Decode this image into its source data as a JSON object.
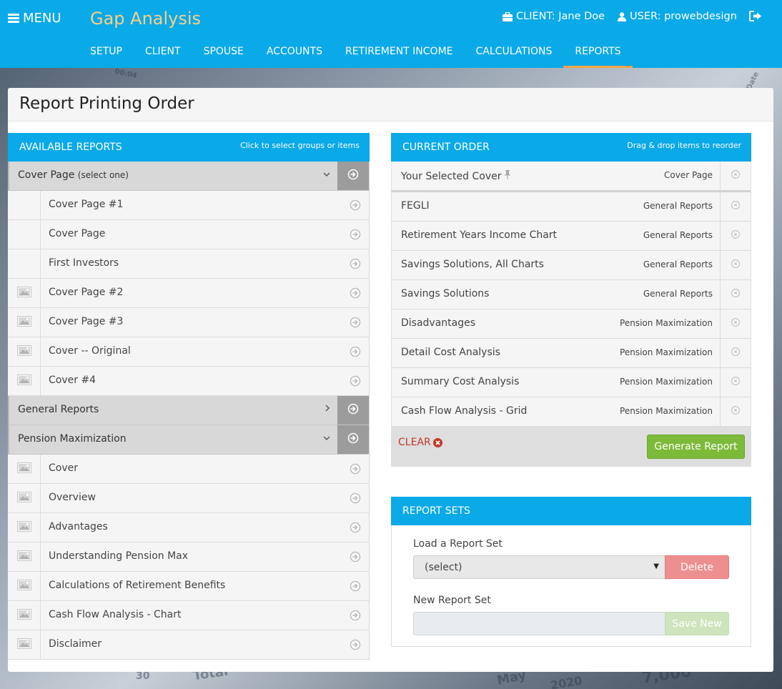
{
  "header": {
    "menu_label": "MENU",
    "app_title": "Gap Analysis",
    "client_label": "CLIENT: Jane Doe",
    "user_label": "USER: prowebdesign"
  },
  "nav": [
    "SETUP",
    "CLIENT",
    "SPOUSE",
    "ACCOUNTS",
    "RETIREMENT INCOME",
    "CALCULATIONS",
    "REPORTS"
  ],
  "nav_active": "REPORTS",
  "page_title": "Report Printing Order",
  "available": {
    "title": "AVAILABLE REPORTS",
    "hint": "Click to select groups or items",
    "groups": [
      {
        "name": "Cover Page",
        "note": "(select one)",
        "expanded": true,
        "items": [
          {
            "label": "Cover Page  #1",
            "thumb": false
          },
          {
            "label": "Cover Page",
            "thumb": false
          },
          {
            "label": "First Investors",
            "thumb": false
          },
          {
            "label": "Cover Page #2",
            "thumb": true
          },
          {
            "label": "Cover Page #3",
            "thumb": true
          },
          {
            "label": "Cover -- Original",
            "thumb": true
          },
          {
            "label": "Cover #4",
            "thumb": true
          }
        ]
      },
      {
        "name": "General Reports",
        "note": "",
        "expanded": false,
        "items": []
      },
      {
        "name": "Pension Maximization",
        "note": "",
        "expanded": true,
        "items": [
          {
            "label": "Cover",
            "thumb": true
          },
          {
            "label": "Overview",
            "thumb": true
          },
          {
            "label": "Advantages",
            "thumb": true
          },
          {
            "label": "Understanding Pension Max",
            "thumb": true
          },
          {
            "label": "Calculations of Retirement Benefits",
            "thumb": true
          },
          {
            "label": "Cash Flow Analysis - Chart",
            "thumb": true
          },
          {
            "label": "Disclaimer",
            "thumb": true
          }
        ]
      }
    ]
  },
  "order": {
    "title": "CURRENT ORDER",
    "hint": "Drag & drop items to reorder",
    "items": [
      {
        "name": "Your Selected Cover",
        "group": "Cover Page",
        "pinned": true
      },
      {
        "name": "FEGLI",
        "group": "General Reports"
      },
      {
        "name": "Retirement Years Income Chart",
        "group": "General Reports"
      },
      {
        "name": "Savings Solutions, All Charts",
        "group": "General Reports"
      },
      {
        "name": "Savings Solutions",
        "group": "General Reports"
      },
      {
        "name": "Disadvantages",
        "group": "Pension Maximization"
      },
      {
        "name": "Detail Cost Analysis",
        "group": "Pension Maximization"
      },
      {
        "name": "Summary Cost Analysis",
        "group": "Pension Maximization"
      },
      {
        "name": "Cash Flow Analysis - Grid",
        "group": "Pension Maximization"
      }
    ],
    "clear_label": "CLEAR",
    "generate_label": "Generate Report"
  },
  "sets": {
    "title": "REPORT SETS",
    "load_label": "Load a Report Set",
    "select_value": "(select)",
    "delete_label": "Delete",
    "new_label": "New Report Set",
    "new_value": "",
    "save_label": "Save New"
  },
  "background_text": [
    "00:04",
    "Date",
    "Total",
    "May",
    "7,000",
    "2020",
    "30"
  ],
  "colors": {
    "header": "#0aa9e8",
    "title_accent": "#f7d08a",
    "active_tab": "#f5a54a",
    "generate": "#7dba3a",
    "delete": "#ee8f8f",
    "save": "#cde4bd",
    "clear": "#c0392b"
  }
}
